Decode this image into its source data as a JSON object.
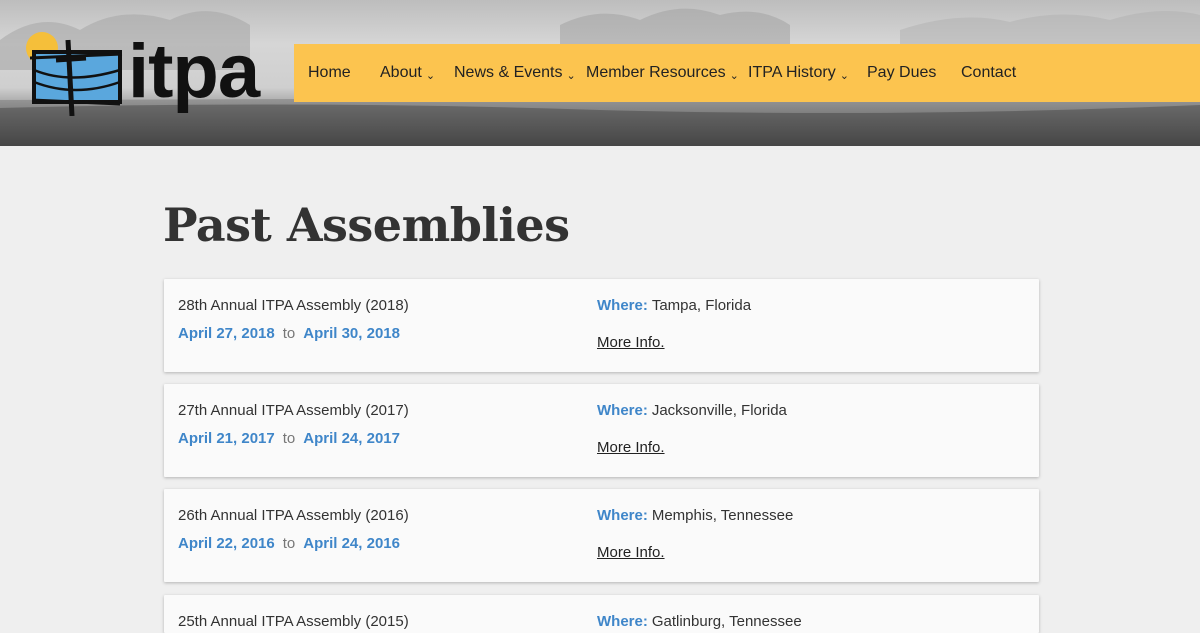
{
  "brand": {
    "logo_text": "itpa",
    "colors": {
      "accent": "#fcc44f",
      "link_blue": "#3f86c9",
      "logo_sky": "#5aa7dd",
      "sun": "#f5bf3a"
    }
  },
  "nav": {
    "items": [
      {
        "label": "Home",
        "has_dropdown": false
      },
      {
        "label": "About",
        "has_dropdown": true
      },
      {
        "label": "News & Events",
        "has_dropdown": true
      },
      {
        "label": "Member Resources",
        "has_dropdown": true
      },
      {
        "label": "ITPA History",
        "has_dropdown": true
      },
      {
        "label": "Pay Dues",
        "has_dropdown": false
      },
      {
        "label": "Contact",
        "has_dropdown": false
      }
    ],
    "chevron": "⌄"
  },
  "main": {
    "title": "Past Assemblies",
    "where_label": "Where:",
    "to_label": "to",
    "more_label": "More Info.",
    "assemblies": [
      {
        "title": "28th Annual ITPA Assembly (2018)",
        "start": "April 27, 2018",
        "end": "April 30, 2018",
        "where": "Tampa, Florida"
      },
      {
        "title": "27th Annual ITPA Assembly (2017)",
        "start": "April 21, 2017",
        "end": "April 24, 2017",
        "where": "Jacksonville, Florida"
      },
      {
        "title": "26th Annual ITPA Assembly (2016)",
        "start": "April 22, 2016",
        "end": "April 24, 2016",
        "where": "Memphis, Tennessee"
      },
      {
        "title": "25th Annual ITPA Assembly (2015)",
        "start": "",
        "end": "",
        "where": "Gatlinburg, Tennessee"
      }
    ]
  }
}
